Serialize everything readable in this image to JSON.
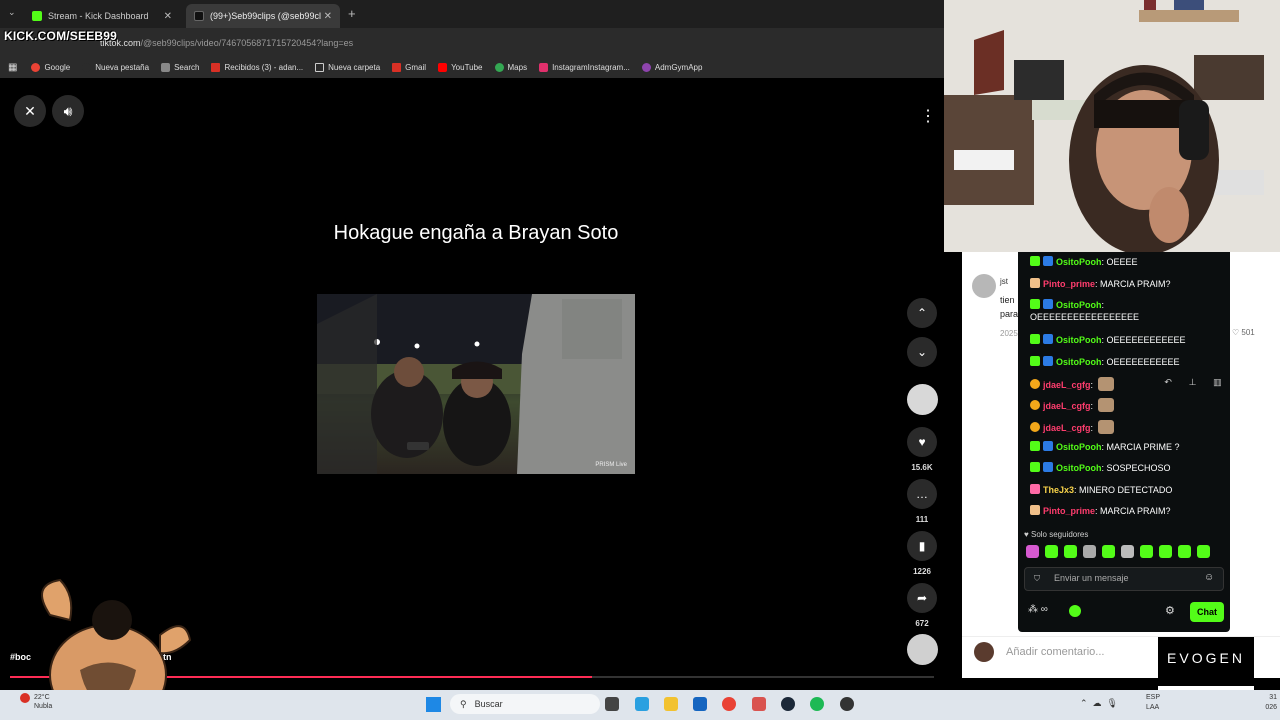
{
  "browser": {
    "tabs": [
      {
        "title": "Stream - Kick Dashboard"
      },
      {
        "title": "(99+)Seb99clips (@seb99cl"
      }
    ],
    "overlay_label": "KICK.COM/SEEB99",
    "url_host": "tiktok.com",
    "url_path": "/@seb99clips/video/7467056871715720454?lang=es",
    "bookmarks": [
      "Google",
      "Nueva pestaña",
      "Search",
      "Recibidos (3) - adan...",
      "Nueva carpeta",
      "Gmail",
      "YouTube",
      "Maps",
      "InstagramInstagram...",
      "AdmGymApp"
    ]
  },
  "video": {
    "title": "Hokague engaña a Brayan Soto",
    "watermark": "PRISM Live",
    "hashtags_left": "#boc",
    "hashtags_right": "m #fitn",
    "progress": 0.63
  },
  "actions": {
    "likes": "15.6K",
    "comments": "111",
    "saves": "1226",
    "shares": "672"
  },
  "comments_panel": {
    "user": "jst",
    "text_start": "tien",
    "text_line2": "para",
    "year": "2025",
    "likes": "501",
    "input_placeholder": "Añadir comentario..."
  },
  "chat": {
    "messages": [
      {
        "user": "OsitoPooh",
        "text": "OEEEE",
        "color": "green"
      },
      {
        "user": "Pinto_prime",
        "text": "MARCIA PRAIM?",
        "color": "red"
      },
      {
        "user": "OsitoPooh",
        "text": "OEEEEEEEEEEEEEEEEE",
        "color": "green"
      },
      {
        "user": "OsitoPooh",
        "text": "OEEEEEEEEEEEE",
        "color": "green"
      },
      {
        "user": "OsitoPooh",
        "text": "OEEEEEEEEEEE",
        "color": "green"
      },
      {
        "user": "jdaeL_cgfg",
        "text": "",
        "color": "red"
      },
      {
        "user": "jdaeL_cgfg",
        "text": "",
        "color": "red"
      },
      {
        "user": "jdaeL_cgfg",
        "text": "",
        "color": "red"
      },
      {
        "user": "OsitoPooh",
        "text": "MARCIA PRIME ?",
        "color": "green"
      },
      {
        "user": "OsitoPooh",
        "text": "SOSPECHOSO",
        "color": "green"
      },
      {
        "user": "TheJx3",
        "text": "MINERO DETECTADO",
        "color": "yellow"
      },
      {
        "user": "Pinto_prime",
        "text": "MARCIA PRAIM?",
        "color": "red"
      }
    ],
    "followers_only": "Solo seguidores",
    "input_placeholder": "Enviar un mensaje",
    "chat_button": "Chat"
  },
  "sponsor": {
    "brand": "EVOGEN"
  },
  "taskbar": {
    "weather_temp": "22°C",
    "weather_desc": "Nubla",
    "search_placeholder": "Buscar",
    "lang_top": "ESP",
    "lang_bottom": "LAA",
    "time": "31",
    "date": "026"
  },
  "colors": {
    "kick_green": "#53fc18",
    "tiktok_red": "#fe2c55"
  }
}
